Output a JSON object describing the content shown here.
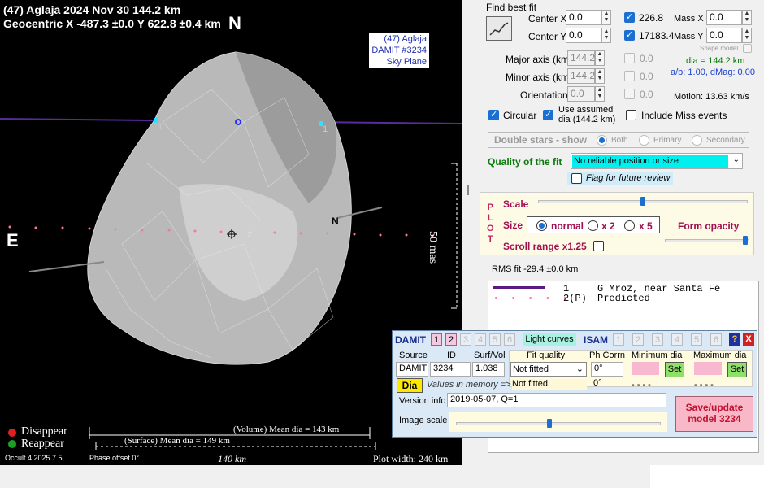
{
  "plot": {
    "header_line1": "(47) Aglaja  2024 Nov 30   144.2 km",
    "header_line2": "Geocentric  X  -487.3 ±0.0  Y 622.8 ±0.4 km",
    "north": "N",
    "east": "E",
    "id_box": [
      "(47) Aglaja",
      "DAMIT #3234",
      "Sky Plane"
    ],
    "scale_label": "50 mas",
    "n_marker": "N",
    "chord_label_1": "1",
    "chord_label_1b": "1",
    "chord_label_2": "2",
    "disappear_label": "Disappear",
    "reappear_label": "Reappear",
    "disappear_color": "#e02020",
    "reappear_color": "#20a020",
    "volume_dia": "(Volume) Mean dia = 143 km",
    "surface_dia": "(Surface) Mean dia = 149 km",
    "version": "Occult 4.2025.7.5",
    "phase_offset": "Phase offset 0°",
    "scale_bar": "140 km",
    "plot_width": "Plot width: 240 km"
  },
  "panel": {
    "find_best_fit": "Find best fit",
    "center_x_label": "Center X",
    "center_x": "0.0",
    "center_y_label": "Center Y",
    "center_y": "0.0",
    "val1": "226.8",
    "val2": "17183.4",
    "mass_x_label": "Mass X",
    "mass_x": "0.0",
    "mass_y_label": "Mass Y",
    "mass_y": "0.0",
    "shape_model_label": "Shape model",
    "major_label": "Major axis (km)",
    "major": "144.2",
    "minor_label": "Minor axis (km)",
    "minor": "144.2",
    "orient_label": "Orientation",
    "orient": "0.0",
    "zero1": "0.0",
    "zero2": "0.0",
    "zero3": "0.0",
    "dia_text": "dia = 144.2 km",
    "ab_text": "a/b: 1.00, dMag: 0.00",
    "motion_text": "Motion: 13.63 km/s",
    "circular_label": "Circular",
    "assumed_label_1": "Use assumed",
    "assumed_label_2": "dia (144.2 km)",
    "include_miss": "Include Miss events",
    "double_stars": "Double stars - show",
    "both": "Both",
    "primary": "Primary",
    "secondary": "Secondary",
    "quality_label": "Quality of the fit",
    "quality_value": "No reliable position or size",
    "flag_label": "Flag for future review",
    "plot_letters": [
      "P",
      "L",
      "O",
      "T"
    ],
    "scale_label": "Scale",
    "size_label": "Size",
    "normal_label": "normal",
    "x2_label": "x 2",
    "x5_label": "x 5",
    "form_opacity": "Form opacity",
    "scroll_range": "Scroll range x1.25",
    "rms_fit": "RMS fit -29.4 ±0.0 km",
    "legend_row1_num": "1",
    "legend_row1_text": "G Mroz, near Santa Fe",
    "legend_row2_num": "2(P)",
    "legend_row2_text": "Predicted"
  },
  "damit": {
    "title": "DAMIT",
    "tabs": [
      "1",
      "2",
      "3",
      "4",
      "5",
      "6"
    ],
    "light_curves": "Light curves",
    "isam": "ISAM",
    "isam_tabs": [
      "1",
      "2",
      "3",
      "4",
      "5",
      "6"
    ],
    "help": "?",
    "close": "X",
    "source_label": "Source",
    "id_label": "ID",
    "surf_label": "Surf/Vol",
    "source": "DAMIT",
    "id": "3234",
    "surf": "1.038",
    "fit_quality_label": "Fit quality",
    "fit_quality": "Not fitted",
    "not_fitted_2": "Not fitted",
    "ph_corr_label": "Ph Corrn",
    "ph_corr": "0°",
    "ph_corr_2": "0°",
    "min_dia_label": "Minimum dia",
    "max_dia_label": "Maximum dia",
    "set": "Set",
    "dashes": "- - - -",
    "dia_button": "Dia",
    "values_memory": "Values in memory =>",
    "version_label": "Version info",
    "version": "2019-05-07, Q=1",
    "image_scale_label": "Image scale",
    "save_button": "Save/update model 3234"
  },
  "colors": {
    "accent": "#1a6fd0",
    "quality_bg": "#00f0f0",
    "save_bg": "#f8b8c8"
  }
}
